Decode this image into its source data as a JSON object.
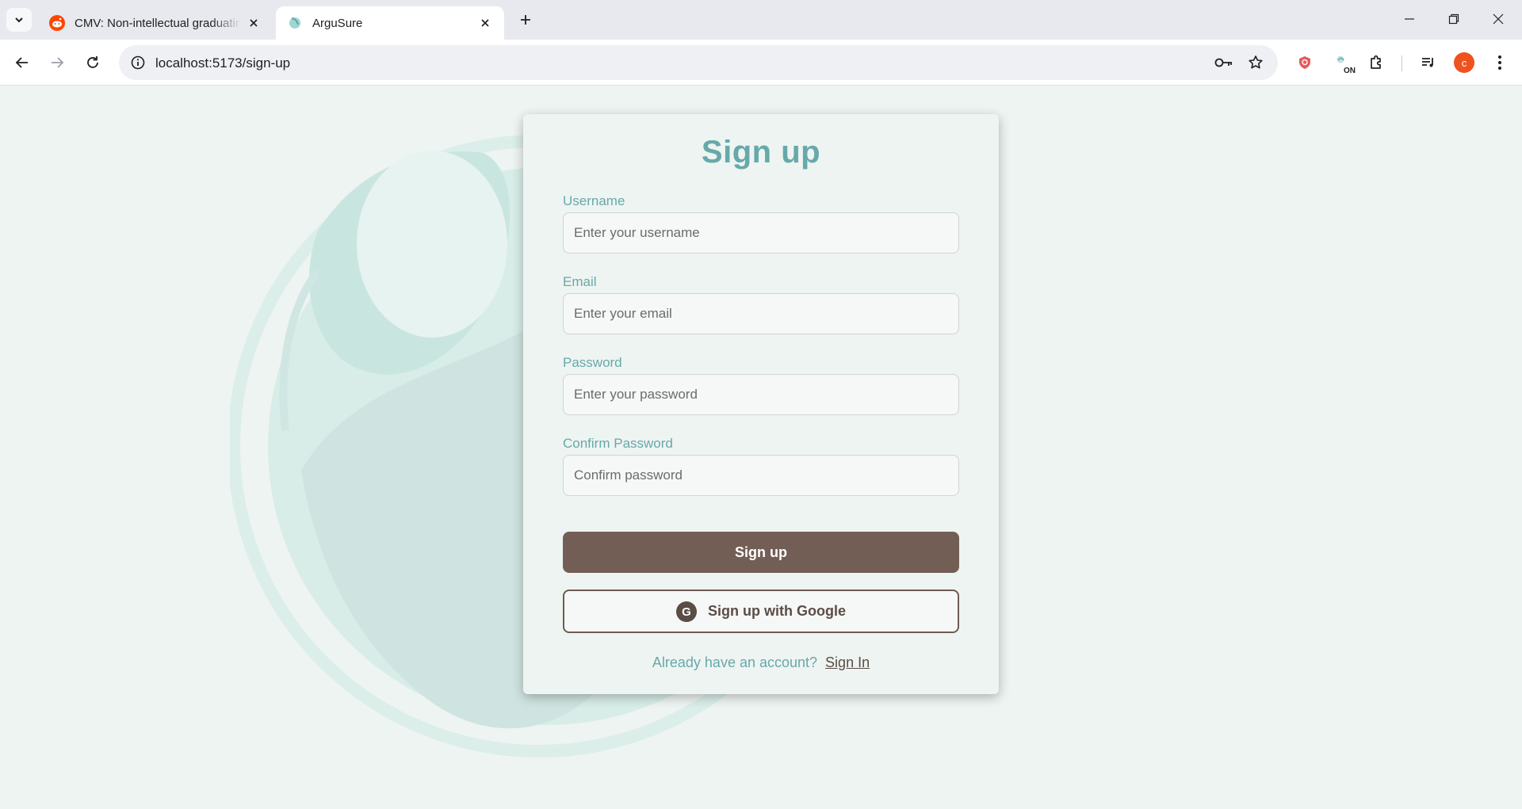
{
  "browser": {
    "tabs": [
      {
        "title": "CMV: Non-intellectual graduating",
        "favicon": "reddit-icon",
        "active": false
      },
      {
        "title": "ArguSure",
        "favicon": "argusure-icon",
        "active": true
      }
    ],
    "url": "localhost:5173/sign-up",
    "extension_badge": "ON",
    "profile_initial": "c",
    "colors": {
      "profile": "#f0521f",
      "reddit": "#ff4500"
    }
  },
  "signup": {
    "title": "Sign up",
    "fields": [
      {
        "label": "Username",
        "placeholder": "Enter your username",
        "type": "text"
      },
      {
        "label": "Email",
        "placeholder": "Enter your email",
        "type": "email"
      },
      {
        "label": "Password",
        "placeholder": "Enter your password",
        "type": "password"
      },
      {
        "label": "Confirm Password",
        "placeholder": "Confirm password",
        "type": "password"
      }
    ],
    "submit_label": "Sign up",
    "google_label": "Sign up with Google",
    "google_icon_letter": "G",
    "footer_text": "Already have an account?",
    "footer_link": "Sign In"
  },
  "theme": {
    "accent": "#67a9ab",
    "primary_button": "#735e55",
    "background": "#eef4f1"
  }
}
